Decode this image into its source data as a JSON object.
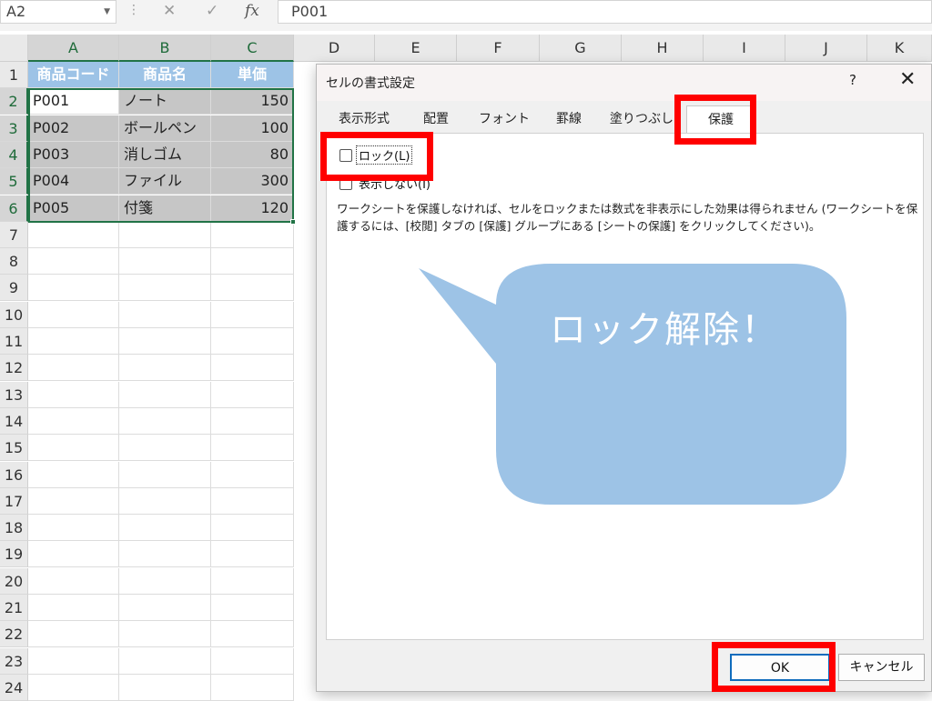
{
  "formula_bar": {
    "name_box": "A2",
    "formula": "P001",
    "icons": [
      "cancel-icon",
      "enter-icon",
      "function-icon"
    ],
    "fx_label": "fx"
  },
  "columns": [
    "A",
    "B",
    "C",
    "D",
    "E",
    "F",
    "G",
    "H",
    "I",
    "J",
    "K"
  ],
  "rows": [
    "1",
    "2",
    "3",
    "4",
    "5",
    "6",
    "7",
    "8",
    "9",
    "10",
    "11",
    "12",
    "13",
    "14",
    "15",
    "16",
    "17",
    "18",
    "19",
    "20",
    "21",
    "22",
    "23",
    "24"
  ],
  "table": {
    "headers": [
      "商品コード",
      "商品名",
      "単価"
    ],
    "rows": [
      [
        "P001",
        "ノート",
        "150"
      ],
      [
        "P002",
        "ボールペン",
        "100"
      ],
      [
        "P003",
        "消しゴム",
        "80"
      ],
      [
        "P004",
        "ファイル",
        "300"
      ],
      [
        "P005",
        "付箋",
        "120"
      ]
    ]
  },
  "dialog": {
    "title": "セルの書式設定",
    "help": "?",
    "close": "✕",
    "tabs": [
      "表示形式",
      "配置",
      "フォント",
      "罫線",
      "塗りつぶし",
      "保護"
    ],
    "active_tab": "保護",
    "lock_label": "ロック(L)",
    "hidden_label": "表示しない(I)",
    "description": "ワークシートを保護しなければ、セルをロックまたは数式を非表示にした効果は得られません (ワークシートを保護するには、[校閲] タブの [保護] グループにある [シートの保護] をクリックしてください)。",
    "ok_label": "OK",
    "cancel_label": "キャンセル"
  },
  "annotation": {
    "bubble_text": "ロック解除！",
    "bubble_color": "#9dc3e6",
    "highlight_color": "#ff0000"
  },
  "colors": {
    "header_fill": "#9dc3e6",
    "selection_fill": "#c6c6c6",
    "selection_border": "#217346"
  }
}
